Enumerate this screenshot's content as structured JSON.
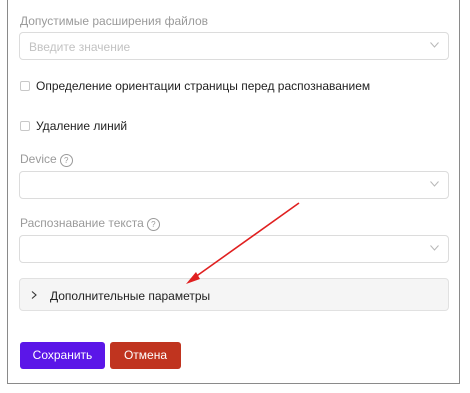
{
  "form": {
    "extensions": {
      "label": "Допустимые расширения файлов",
      "placeholder": "Введите значение",
      "icon": "chevron-down-icon"
    },
    "orientation_checkbox": {
      "label": "Определение ориентации страницы перед распознаванием",
      "checked": false
    },
    "lines_checkbox": {
      "label": "Удаление линий",
      "checked": false
    },
    "device": {
      "label": "Device",
      "help_glyph": "?",
      "value": ""
    },
    "text_recognition": {
      "label": "Распознавание текста",
      "help_glyph": "?",
      "value": ""
    },
    "advanced": {
      "label": "Дополнительные параметры",
      "expanded": false
    }
  },
  "buttons": {
    "save_label": "Сохранить",
    "cancel_label": "Отмена"
  },
  "colors": {
    "save": "#5b16e8",
    "cancel": "#c0341f",
    "annotation_arrow": "#e02020"
  }
}
